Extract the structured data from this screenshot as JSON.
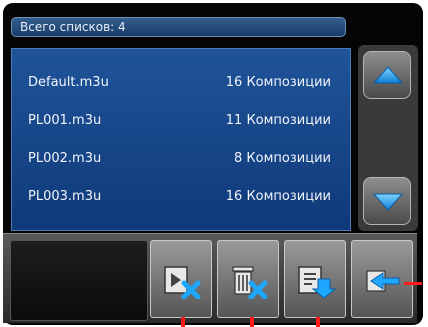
{
  "header": {
    "total_lists_label": "Всего списков: 4"
  },
  "playlists": [
    {
      "name": "Default.m3u",
      "count": "16 Композиции"
    },
    {
      "name": "PL001.m3u",
      "count": "11 Композиции"
    },
    {
      "name": "PL002.m3u",
      "count": "8 Композиции"
    },
    {
      "name": "PL003.m3u",
      "count": "16 Композиции"
    }
  ],
  "icons": {
    "scroll_up": "triangle-up-icon",
    "scroll_down": "triangle-down-icon",
    "remove_playlist": "playlist-remove-icon",
    "delete_playlist": "trash-icon",
    "save_playlist": "playlist-save-icon",
    "back": "back-arrow-icon"
  },
  "colors": {
    "list_background": "#1a4a8f",
    "accent_blue": "#1ea7ff",
    "marker_red": "#ff1a1a"
  }
}
